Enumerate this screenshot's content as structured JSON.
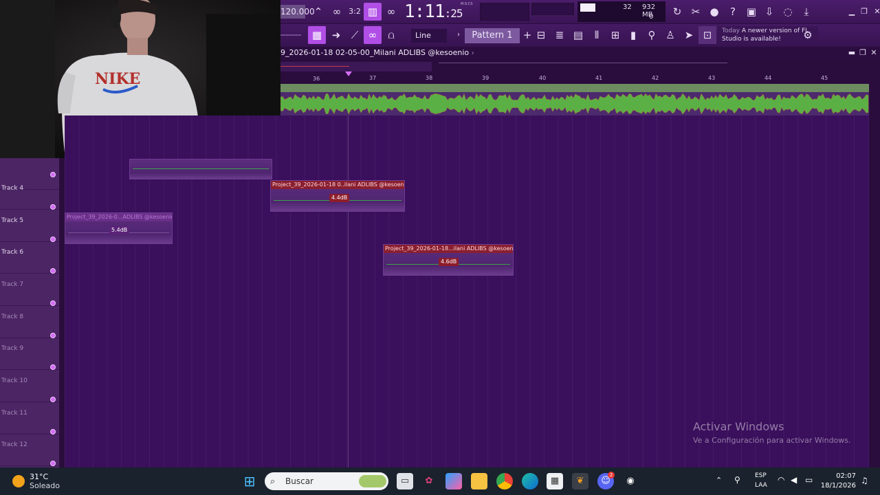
{
  "toolbar": {
    "tempo": "120.000",
    "time": {
      "main": "1:11",
      "sub": ":25",
      "unit_label": "M:S:CS"
    },
    "cpu": "32",
    "memory": "932 MB",
    "polyphony": "0",
    "snap_mode": "Line",
    "pattern": "Pattern 1",
    "hint_date": "Today",
    "hint_text": "A newer version of FL Studio is available!"
  },
  "playlist": {
    "title": "9_2026-01-18 02-05-00_Milani ADLIBS @kesoenio",
    "ruler": [
      "36",
      "37",
      "38",
      "39",
      "40",
      "41",
      "42",
      "43",
      "44",
      "45"
    ]
  },
  "tracks": [
    {
      "label": "Track 4"
    },
    {
      "label": "Track 5"
    },
    {
      "label": "Track 6"
    },
    {
      "label": "Track 7"
    },
    {
      "label": "Track 8"
    },
    {
      "label": "Track 9"
    },
    {
      "label": "Track 10"
    },
    {
      "label": "Track 11"
    },
    {
      "label": "Track 12"
    }
  ],
  "clips": [
    {
      "name": "Project_39_2026-01-18 0..ilani ADLIBS @kesoenio",
      "gain": "4.4dB",
      "muted": false
    },
    {
      "name": "Project_39_2026-0...ADLIBS @kesoenio",
      "gain": "5.4dB",
      "muted": true
    },
    {
      "name": "Project_39_2026-01-18...ilani ADLIBS @kesoenio",
      "gain": "4.6dB",
      "muted": false
    }
  ],
  "watermark": {
    "title": "Activar Windows",
    "subtitle": "Ve a Configuración para activar Windows."
  },
  "taskbar": {
    "weather_temp": "31°C",
    "weather_desc": "Soleado",
    "search_placeholder": "Buscar",
    "discord_badge": "2",
    "lang_top": "ESP",
    "lang_bottom": "LAA",
    "clock_time": "02:07",
    "clock_date": "18/1/2026"
  }
}
